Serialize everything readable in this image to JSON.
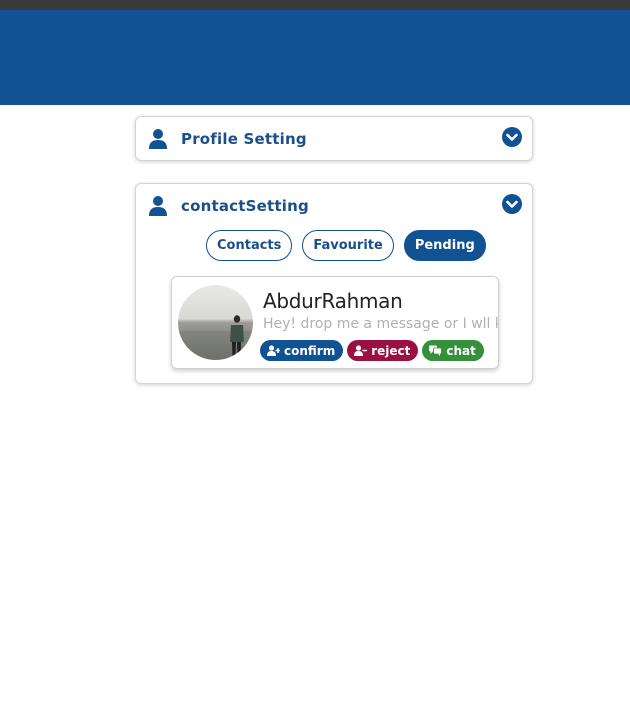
{
  "header": {},
  "profile_panel": {
    "title": "Profile Setting",
    "icon": "user-icon",
    "toggle_icon": "chevron-down-circle-icon"
  },
  "contact_panel": {
    "title": "contactSetting",
    "icon": "user-icon",
    "toggle_icon": "chevron-down-circle-icon",
    "tabs": [
      {
        "label": "Contacts",
        "active": false
      },
      {
        "label": "Favourite",
        "active": false
      },
      {
        "label": "Pending",
        "active": true
      }
    ],
    "contact": {
      "name": "AbdurRahman",
      "message": "Hey! drop me a message or I wll keep waiting",
      "avatar": "person-photo",
      "actions": {
        "confirm_label": "confirm",
        "reject_label": "reject",
        "chat_label": "chat"
      }
    }
  },
  "colors": {
    "primary": "#115293",
    "reject": "#9b1042",
    "chat": "#34903a",
    "title_text": "#1b4f8a"
  }
}
